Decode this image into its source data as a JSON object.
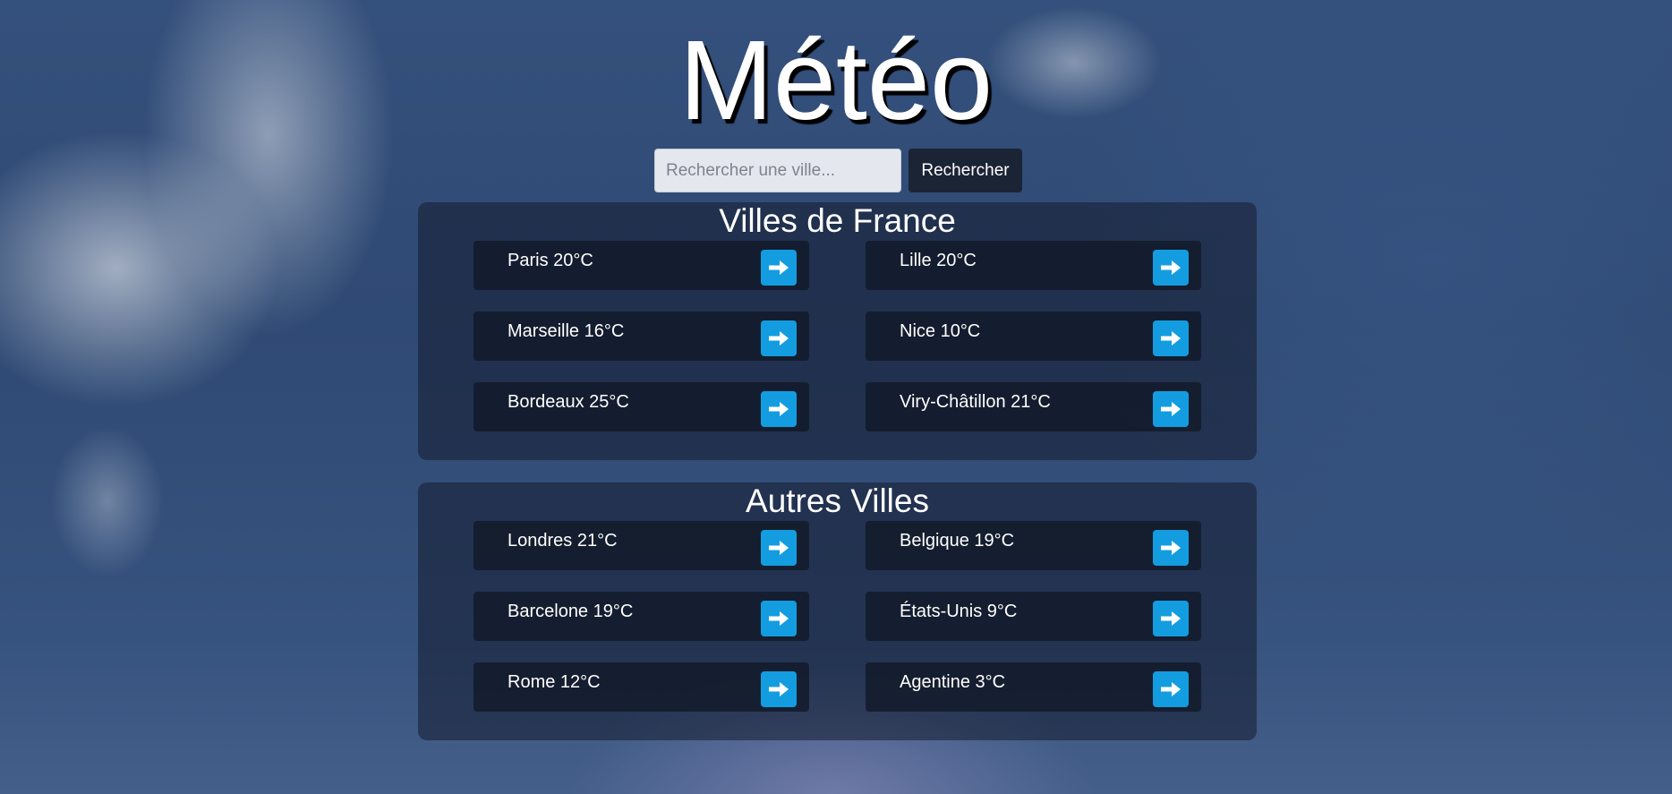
{
  "header": {
    "title": "Météo"
  },
  "search": {
    "placeholder": "Rechercher une ville...",
    "value": "",
    "button_label": "Rechercher"
  },
  "sections": [
    {
      "title": "Villes de France",
      "cities": [
        {
          "label": "Paris 20°C",
          "icon": "arrow-right-icon"
        },
        {
          "label": "Lille 20°C",
          "icon": "arrow-right-icon"
        },
        {
          "label": "Marseille 16°C",
          "icon": "arrow-right-icon"
        },
        {
          "label": "Nice 10°C",
          "icon": "arrow-right-icon"
        },
        {
          "label": "Bordeaux 25°C",
          "icon": "arrow-right-icon"
        },
        {
          "label": "Viry-Châtillon 21°C",
          "icon": "arrow-right-icon"
        }
      ]
    },
    {
      "title": "Autres Villes",
      "cities": [
        {
          "label": "Londres 21°C",
          "icon": "arrow-right-icon"
        },
        {
          "label": "Belgique 19°C",
          "icon": "arrow-right-icon"
        },
        {
          "label": "Barcelone 19°C",
          "icon": "arrow-right-icon"
        },
        {
          "label": "États-Unis 9°C",
          "icon": "arrow-right-icon"
        },
        {
          "label": "Rome 12°C",
          "icon": "arrow-right-icon"
        },
        {
          "label": "Agentine 3°C",
          "icon": "arrow-right-icon"
        }
      ]
    }
  ],
  "colors": {
    "accent": "#139de0",
    "panel": "#141c2d",
    "card": "#111826",
    "search_button": "#1b2435"
  }
}
